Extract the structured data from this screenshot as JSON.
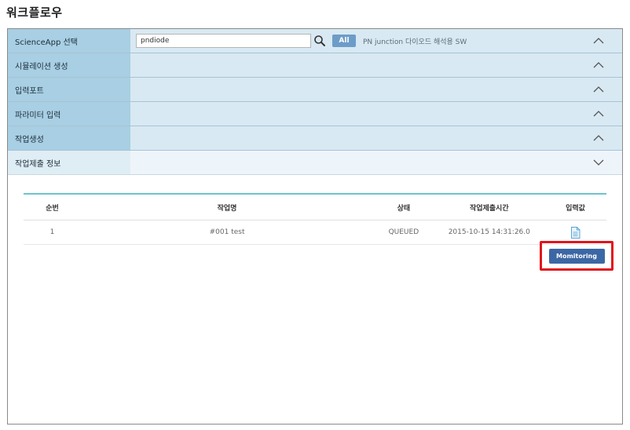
{
  "page": {
    "title": "워크플로우"
  },
  "accordion": {
    "rows": [
      {
        "label": "ScienceApp 선택",
        "chevron": "up"
      },
      {
        "label": "시뮬레이션 생성",
        "chevron": "up"
      },
      {
        "label": "입력포트",
        "chevron": "up"
      },
      {
        "label": "파라미터 입력",
        "chevron": "up"
      },
      {
        "label": "작업생성",
        "chevron": "up"
      },
      {
        "label": "작업제출 정보",
        "chevron": "down"
      }
    ]
  },
  "science_app": {
    "search_value": "pndiode",
    "search_icon": "search-icon",
    "all_label": "All",
    "description": "PN junction 다이오드 해석용 SW",
    "accent_color": "#6d9cc8"
  },
  "jobs_table": {
    "headers": {
      "no": "순번",
      "name": "작업명",
      "status": "상태",
      "submit_time": "작업제출시간",
      "input": "입력값"
    },
    "rows": [
      {
        "no": "1",
        "name": "#001 test",
        "status": "QUEUED",
        "submit_time": "2015-10-15 14:31:26.0",
        "input_icon": "document-icon"
      }
    ]
  },
  "monitoring": {
    "label": "Momitoring",
    "button_color": "#3c67a5",
    "highlight_color": "#e0141b"
  }
}
